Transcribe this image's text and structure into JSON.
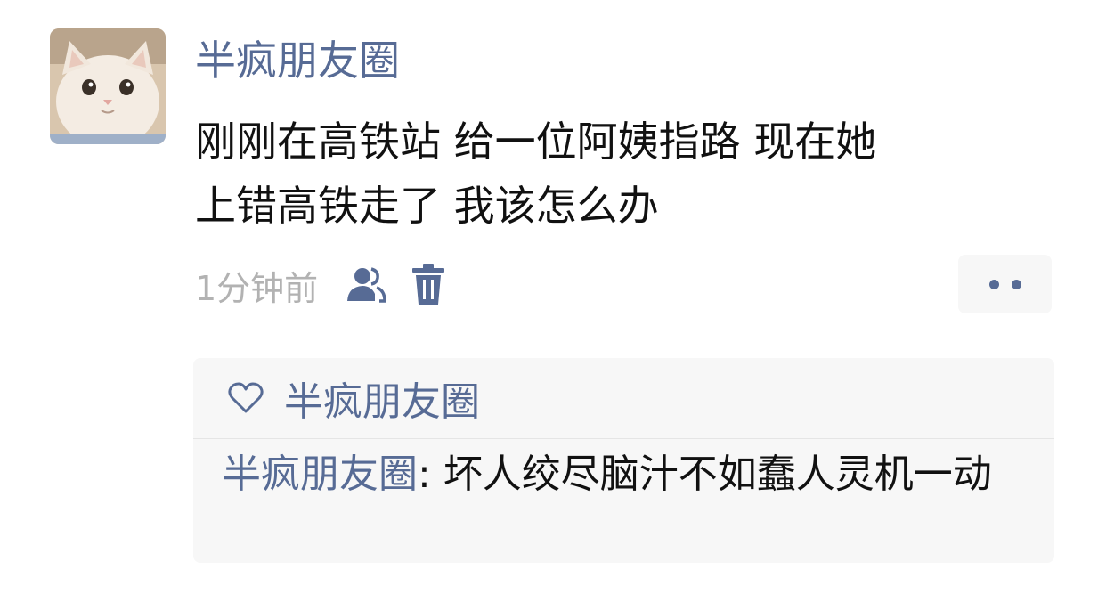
{
  "post": {
    "author": "半疯朋友圈",
    "content_lines": [
      "刚刚在高铁站 给一位阿姨指路 现在她",
      "上错高铁走了 我该怎么办"
    ],
    "time": "1分钟前",
    "friends_icon": "friends-visibility-icon",
    "delete_icon": "trash-icon"
  },
  "interactions": {
    "like_icon": "heart-outline-icon",
    "likers": "半疯朋友圈",
    "comments": [
      {
        "author": "半疯朋友圈",
        "separator": ": ",
        "text": "坏人绞尽脑汁不如蠢人灵机一动"
      }
    ]
  },
  "colors": {
    "link": "#576b95",
    "text": "#111111",
    "muted": "#b2b2b2",
    "panel": "#f7f7f7"
  }
}
